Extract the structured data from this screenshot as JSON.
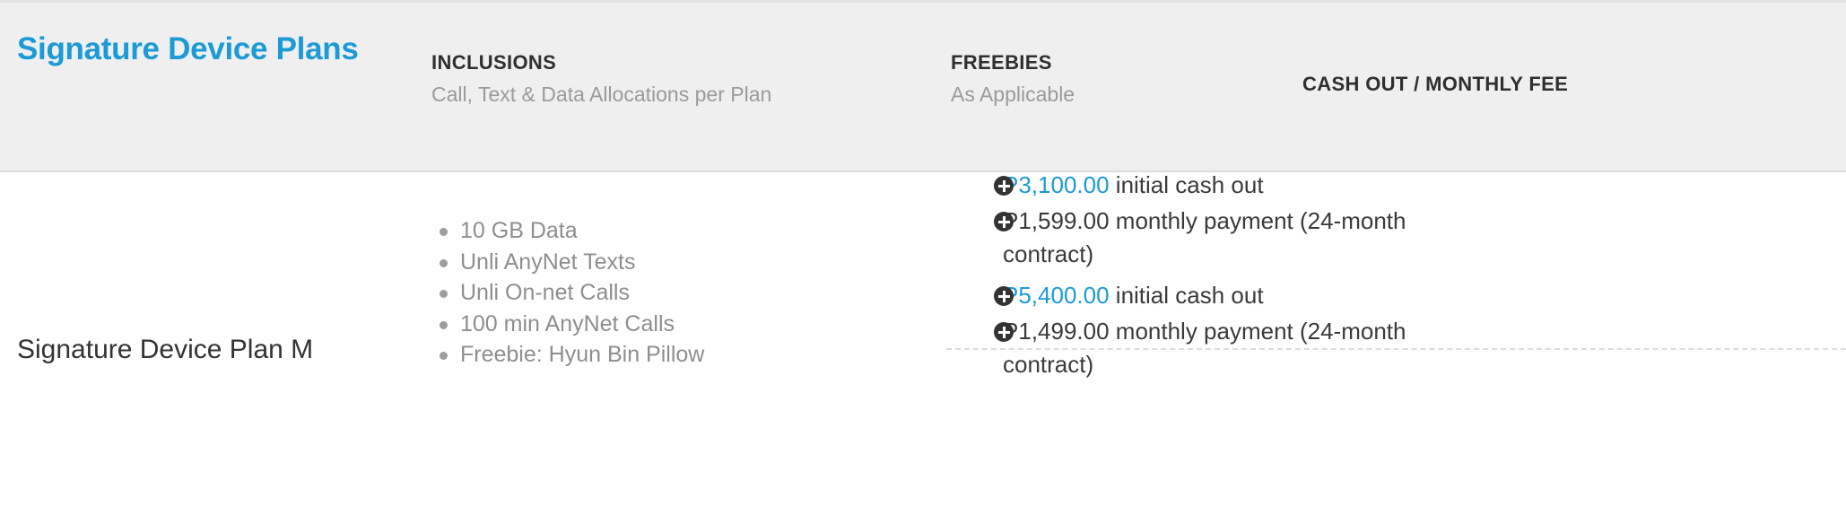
{
  "header": {
    "title": "Signature Device Plans",
    "columns": [
      {
        "label": "INCLUSIONS",
        "sublabel": "Call, Text & Data Allocations per Plan"
      },
      {
        "label": "FREEBIES",
        "sublabel": "As Applicable"
      },
      {
        "label": "CASH OUT / MONTHLY FEE",
        "sublabel": ""
      }
    ]
  },
  "row": {
    "plan_name": "Signature Device Plan M",
    "inclusions": [
      "10 GB Data",
      "Unli AnyNet Texts",
      "Unli On-net Calls",
      "100 min AnyNet Calls",
      "Freebie: Hyun Bin Pillow"
    ],
    "freebies": "",
    "fee_options": [
      {
        "initial_amount": "P3,100.00",
        "initial_text": " initial cash out",
        "monthly_amount": "P1,599.00",
        "monthly_text": " monthly payment (24-month",
        "monthly_text_wrap": "contract)"
      },
      {
        "initial_amount": "P5,400.00",
        "initial_text": " initial cash out",
        "monthly_amount": "P1,499.00",
        "monthly_text": " monthly payment (24-month",
        "monthly_text_wrap": "contract)"
      }
    ]
  },
  "icons": {
    "bullet": "bullet-dot-icon",
    "plus": "plus-circle-icon"
  },
  "colors": {
    "accent_blue": "#1b9ad6",
    "header_bg": "#efefef",
    "muted_text": "#8e8e8e",
    "body_text": "#3a3a3a",
    "icon_dark": "#333333",
    "divider": "#dcdcdc"
  }
}
